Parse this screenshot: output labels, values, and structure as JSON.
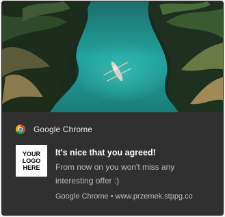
{
  "notification": {
    "app_name": "Google Chrome",
    "app_icon": "chrome-icon",
    "hero_image": "river-boat-jungle-photo",
    "logo": {
      "lines": [
        "YOUR",
        "LOGO",
        "HERE"
      ]
    },
    "title": "It's nice that you agreed!",
    "message": "From now on you won't miss any interesting offer :)",
    "footer": {
      "source": "Google Chrome",
      "separator": "•",
      "domain": "www.przemek.stppg.co"
    }
  },
  "colors": {
    "background": "#303030",
    "title": "#ffffff",
    "secondary_text": "#bdbdbd",
    "water": "#1f9e98"
  }
}
